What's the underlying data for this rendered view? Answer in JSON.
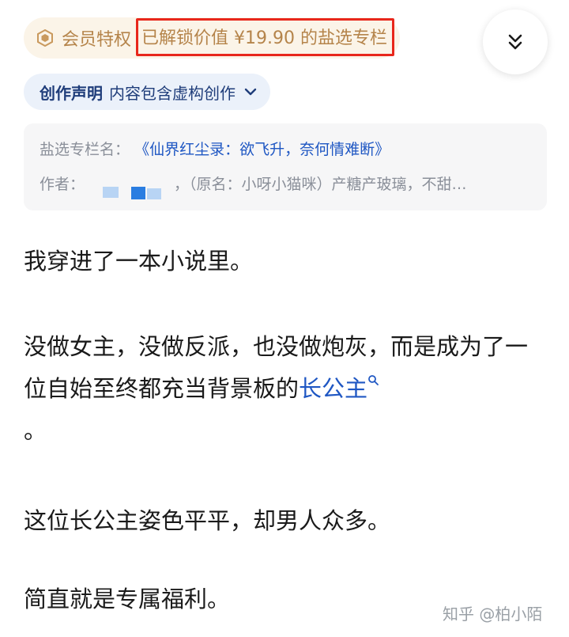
{
  "member": {
    "icon": "crown-icon",
    "label": "会员特权",
    "unlock_text": "已解锁价值 ¥19.90 的盐选专栏",
    "accent": "#b5844a",
    "highlight_border": "#e8271c"
  },
  "collapse_button": {
    "icon": "double-chevron-down-icon"
  },
  "declaration": {
    "title": "创作声明",
    "text": "内容包含虚构创作",
    "icon": "chevron-down-icon"
  },
  "column_info": {
    "name_label": "盐选专栏名：",
    "name_value": "《仙界红尘录：欲飞升，奈何情难断》",
    "author_label": "作者：",
    "author_rest": "，（原名：小呀小猫咪）产糖产玻璃，不甜…"
  },
  "article": {
    "paragraphs": [
      {
        "text": "我穿进了一本小说里。"
      },
      {
        "before": "没做女主，没做反派，也没做炮灰，而是成为了一位自始至终都充当背景板的",
        "keyword": "长公主",
        "after": "。"
      },
      {
        "text": "这位长公主姿色平平，却男人众多。"
      },
      {
        "text": "简直就是专属福利。"
      }
    ]
  },
  "watermark": "知乎 @柏小陌"
}
